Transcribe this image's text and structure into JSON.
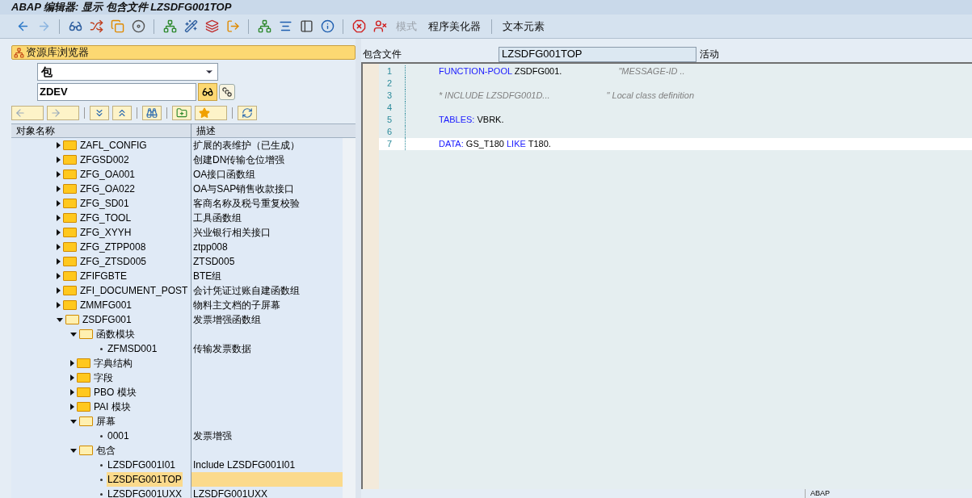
{
  "window": {
    "title": "ABAP 编辑器: 显示 包含文件 LZSDFG001TOP"
  },
  "toolbar": [
    {
      "kind": "icon"
    },
    {
      "kind": "icon"
    },
    {
      "kind": "sep"
    },
    {
      "kind": "icon"
    },
    {
      "kind": "icon"
    },
    {
      "kind": "icon"
    },
    {
      "kind": "icon"
    },
    {
      "kind": "sep"
    },
    {
      "kind": "icon"
    },
    {
      "kind": "icon"
    },
    {
      "kind": "icon"
    },
    {
      "kind": "icon"
    },
    {
      "kind": "sep"
    },
    {
      "kind": "icon"
    },
    {
      "kind": "icon"
    },
    {
      "kind": "icon"
    },
    {
      "kind": "icon"
    },
    {
      "kind": "sep"
    },
    {
      "kind": "icon"
    },
    {
      "kind": "icon"
    },
    {
      "kind": "text",
      "label": "模式",
      "disabled": true
    },
    {
      "kind": "text",
      "label": "程序美化器",
      "disabled": false
    },
    {
      "kind": "sep"
    },
    {
      "kind": "text",
      "label": "文本元素",
      "disabled": false
    }
  ],
  "browser": {
    "title": "资源库浏览器",
    "object_type": "包",
    "object_name": "ZDEV",
    "columns": [
      "对象名称",
      "描述"
    ],
    "tree": [
      {
        "kind": "folder",
        "name": "ZAFL_CONFIG",
        "desc": "扩展的表维护（已生成）",
        "expanded": false,
        "selected": false
      },
      {
        "kind": "folder",
        "name": "ZFGSD002",
        "desc": "创建DN传输仓位增强",
        "expanded": false,
        "selected": false
      },
      {
        "kind": "folder",
        "name": "ZFG_OA001",
        "desc": "OA接口函数组",
        "expanded": false,
        "selected": false
      },
      {
        "kind": "folder",
        "name": "ZFG_OA022",
        "desc": "OA与SAP销售收款接口",
        "expanded": false,
        "selected": false
      },
      {
        "kind": "folder",
        "name": "ZFG_SD01",
        "desc": "客商名称及税号重复校验",
        "expanded": false,
        "selected": false
      },
      {
        "kind": "folder",
        "name": "ZFG_TOOL",
        "desc": "工具函数组",
        "expanded": false,
        "selected": false
      },
      {
        "kind": "folder",
        "name": "ZFG_XYYH",
        "desc": "兴业银行相关接口",
        "expanded": false,
        "selected": false
      },
      {
        "kind": "folder",
        "name": "ZFG_ZTPP008",
        "desc": "ztpp008",
        "expanded": false,
        "selected": false
      },
      {
        "kind": "folder",
        "name": "ZFG_ZTSD005",
        "desc": "ZTSD005",
        "expanded": false,
        "selected": false
      },
      {
        "kind": "folder",
        "name": "ZFIFGBTE",
        "desc": "BTE组",
        "expanded": false,
        "selected": false
      },
      {
        "kind": "folder",
        "name": "ZFI_DOCUMENT_POST",
        "desc": "会计凭证过账自建函数组",
        "expanded": false,
        "selected": false
      },
      {
        "kind": "folder",
        "name": "ZMMFG001",
        "desc": "物料主文档的子屏幕",
        "expanded": false,
        "selected": false
      },
      {
        "kind": "folder",
        "name": "ZSDFG001",
        "desc": "发票增强函数组",
        "expanded": true,
        "selected": false,
        "children": [
          {
            "kind": "folder",
            "name": "函数模块",
            "expanded": true,
            "selected": false,
            "children": [
              {
                "kind": "leaf",
                "name": "ZFMSD001",
                "desc": "传输发票数据",
                "selected": false
              }
            ]
          },
          {
            "kind": "folder",
            "name": "字典结构",
            "expanded": false,
            "selected": false
          },
          {
            "kind": "folder",
            "name": "字段",
            "expanded": false,
            "selected": false
          },
          {
            "kind": "folder",
            "name": "PBO 模块",
            "expanded": false,
            "selected": false
          },
          {
            "kind": "folder",
            "name": "PAI 模块",
            "expanded": false,
            "selected": false
          },
          {
            "kind": "folder",
            "name": "屏幕",
            "expanded": true,
            "selected": false,
            "children": [
              {
                "kind": "leaf",
                "name": "0001",
                "desc": "发票增强",
                "selected": false
              }
            ]
          },
          {
            "kind": "folder",
            "name": "包含",
            "expanded": true,
            "selected": false,
            "children": [
              {
                "kind": "leaf",
                "name": "LZSDFG001I01",
                "desc": "Include LZSDFG001I01",
                "selected": false
              },
              {
                "kind": "leaf",
                "name": "LZSDFG001TOP",
                "selected": true
              },
              {
                "kind": "leaf",
                "name": "LZSDFG001UXX",
                "desc": "LZSDFG001UXX",
                "selected": false
              }
            ]
          }
        ]
      }
    ]
  },
  "editor": {
    "label": "包含文件",
    "include": "LZSDFG001TOP",
    "status": "活动",
    "lines": [
      {
        "number": "1",
        "current": false,
        "tokens": [
          {
            "kind": "keyword",
            "text": "FUNCTION-POOL"
          },
          {
            "kind": "plain",
            "text": " ZSDFG001."
          },
          {
            "kind": "comment",
            "text": "\"MESSAGE-ID .."
          }
        ]
      },
      {
        "number": "2",
        "current": false
      },
      {
        "number": "3",
        "current": false,
        "tokens": [
          {
            "kind": "comment",
            "text": "* INCLUDE LZSDFG001D..."
          },
          {
            "kind": "comment",
            "text": "\" Local class definition"
          }
        ]
      },
      {
        "number": "4",
        "current": false
      },
      {
        "number": "5",
        "current": false,
        "tokens": [
          {
            "kind": "keyword",
            "text": "TABLES:"
          },
          {
            "kind": "plain",
            "text": " VBRK."
          }
        ]
      },
      {
        "number": "6",
        "current": false
      },
      {
        "number": "7",
        "current": true,
        "tokens": [
          {
            "kind": "keyword",
            "text": "DATA:"
          },
          {
            "kind": "plain",
            "text": " GS_T180 "
          },
          {
            "kind": "keyword",
            "text": "LIKE"
          },
          {
            "kind": "plain",
            "text": " T180."
          }
        ]
      }
    ]
  },
  "status_bar": {
    "language": "ABAP"
  }
}
